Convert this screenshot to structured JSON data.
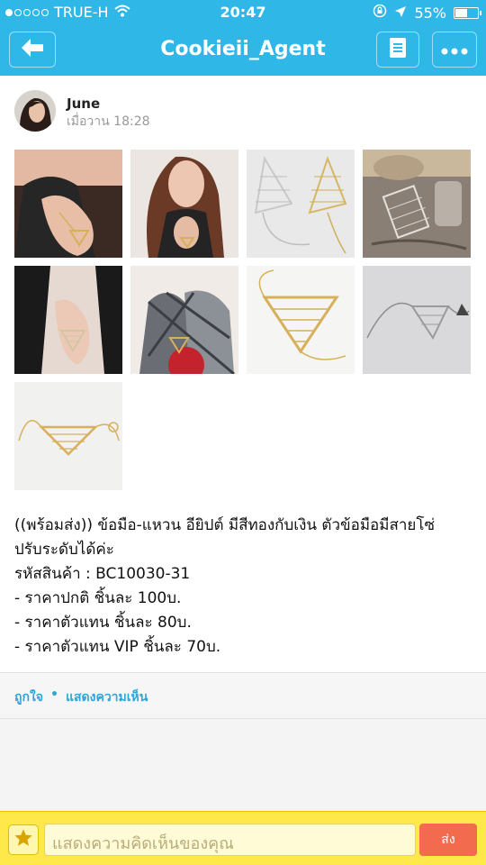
{
  "status_bar": {
    "carrier": "TRUE-H",
    "signal_dots_filled": 1,
    "signal_dots_total": 5,
    "time": "20:47",
    "battery_percent_label": "55%",
    "battery_level": 0.55
  },
  "nav": {
    "title": "Cookieii_Agent",
    "back_icon": "arrow-left-icon",
    "note_icon": "note-icon",
    "more_icon": "more-icon"
  },
  "post": {
    "author": "June",
    "time": "เมื่อวาน 18:28",
    "photos": [
      {
        "icon": "photo-hand-chain"
      },
      {
        "icon": "photo-model"
      },
      {
        "icon": "photo-bracelet-pair"
      },
      {
        "icon": "photo-bracelet-table"
      },
      {
        "icon": "photo-hand-dark"
      },
      {
        "icon": "photo-model-plaid"
      },
      {
        "icon": "photo-gold-bracelet"
      },
      {
        "icon": "photo-silver-bracelet"
      },
      {
        "icon": "photo-gold-bracelet-flat"
      }
    ],
    "caption_lines": [
      "((พร้อมส่ง)) ข้อมือ-แหวน อียิปต์ มีสีทองกับเงิน ตัวข้อมือมีสายโซ่",
      "ปรับระดับได้ค่ะ",
      "รหัสสินค้า : BC10030-31",
      "- ราคาปกติ ชิ้นละ 100บ.",
      "- ราคาตัวแทน ชิ้นละ 80บ.",
      "- ราคาตัวแทน VIP ชิ้นละ 70บ."
    ]
  },
  "actions": {
    "like": "ถูกใจ",
    "separator": "•",
    "comment": "แสดงความเห็น"
  },
  "composer": {
    "placeholder": "แสดงความคิดเห็นของคุณ",
    "send": "ส่ง",
    "sticker_icon": "star-icon"
  },
  "colors": {
    "brand": "#2fb7e8",
    "composer_bg": "#ffe84a",
    "send_button": "#f26b4f",
    "link": "#2fa6d6"
  }
}
